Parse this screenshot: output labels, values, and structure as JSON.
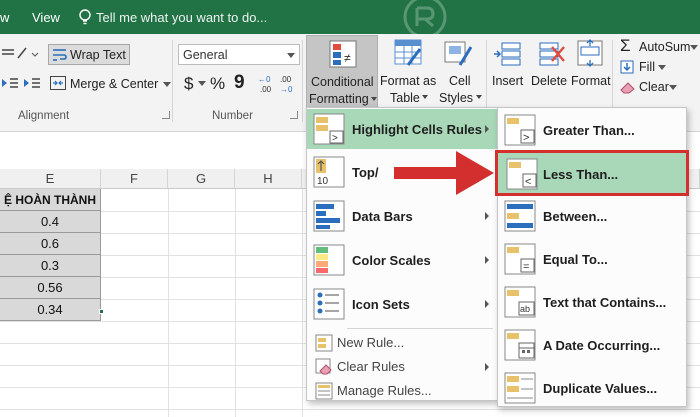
{
  "titlebar": {
    "view_partial": "w",
    "view_tab": "View",
    "tell_me": "Tell me what you want to do..."
  },
  "ribbon": {
    "wrap_text": "Wrap Text",
    "merge_center": "Merge & Center",
    "number_format": "General",
    "currency": "$",
    "percent": "%",
    "comma": "9",
    "conditional_formatting_line1": "Conditional",
    "conditional_formatting_line2": "Formatting",
    "format_as_table_line1": "Format as",
    "format_as_table_line2": "Table",
    "cell_styles_line1": "Cell",
    "cell_styles_line2": "Styles",
    "insert": "Insert",
    "delete": "Delete",
    "format": "Format",
    "autosum": "AutoSum",
    "fill": "Fill",
    "clear": "Clear",
    "group_alignment": "Alignment",
    "group_number": "Number"
  },
  "sheet": {
    "columns": [
      "E",
      "F",
      "G",
      "H"
    ],
    "header_cell": "Ệ HOÀN THÀNH",
    "values": [
      "0.4",
      "0.6",
      "0.3",
      "0.56",
      "0.34"
    ]
  },
  "cf_menu": {
    "items": [
      {
        "label": "Highlight Cells Rules",
        "icon": "highlight-cells-icon"
      },
      {
        "label": "Top/",
        "icon": "top-bottom-icon"
      },
      {
        "label": "Data Bars",
        "icon": "data-bars-icon"
      },
      {
        "label": "Color Scales",
        "icon": "color-scales-icon"
      },
      {
        "label": "Icon Sets",
        "icon": "icon-sets-icon"
      }
    ],
    "small_items": [
      {
        "label": "New Rule...",
        "icon": "new-rule-icon"
      },
      {
        "label": "Clear Rules",
        "icon": "clear-rules-icon"
      },
      {
        "label": "Manage Rules...",
        "icon": "manage-rules-icon"
      }
    ]
  },
  "hl_submenu": {
    "items": [
      {
        "label": "Greater Than...",
        "icon": "greater-than-icon"
      },
      {
        "label": "Less Than...",
        "icon": "less-than-icon"
      },
      {
        "label": "Between...",
        "icon": "between-icon"
      },
      {
        "label": "Equal To...",
        "icon": "equal-to-icon"
      },
      {
        "label": "Text that Contains...",
        "icon": "text-contains-icon"
      },
      {
        "label": "A Date Occurring...",
        "icon": "date-occurring-icon"
      },
      {
        "label": "Duplicate Values...",
        "icon": "duplicate-values-icon"
      }
    ]
  },
  "colors": {
    "title_green": "#217346",
    "highlight_green": "#a9d8b8",
    "callout_red": "#d32f2f"
  }
}
